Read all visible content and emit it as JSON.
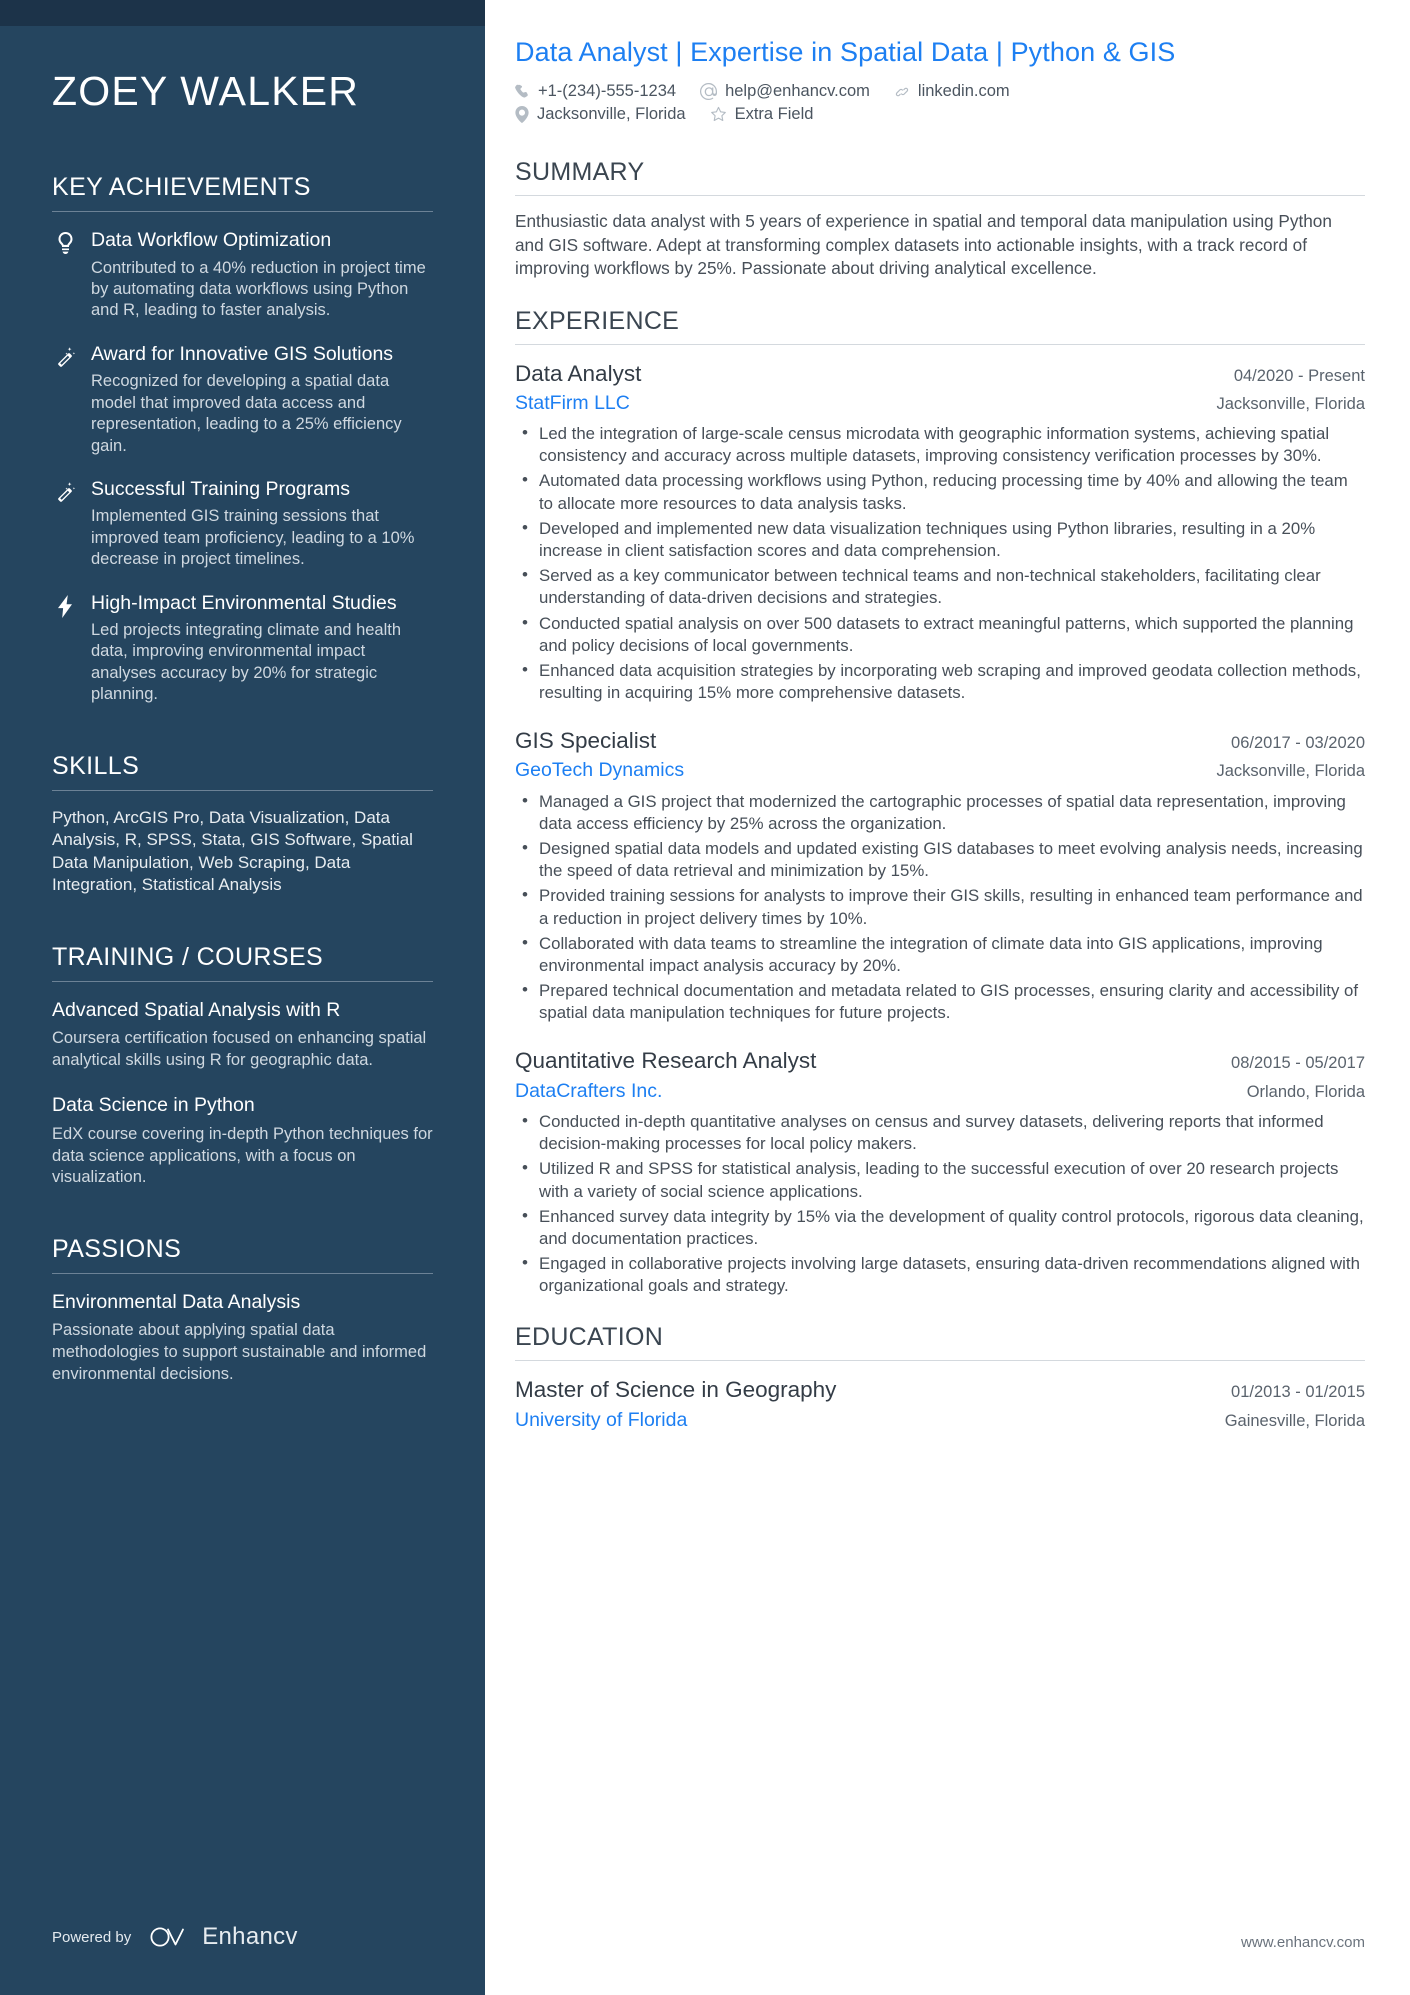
{
  "sidebar": {
    "name": "ZOEY WALKER",
    "achievements": {
      "heading": "KEY ACHIEVEMENTS",
      "items": [
        {
          "icon": "lightbulb-icon",
          "title": "Data Workflow Optimization",
          "description": "Contributed to a 40% reduction in project time by automating data workflows using Python and R, leading to faster analysis."
        },
        {
          "icon": "magic-wand-icon",
          "title": "Award for Innovative GIS Solutions",
          "description": "Recognized for developing a spatial data model that improved data access and representation, leading to a 25% efficiency gain."
        },
        {
          "icon": "magic-wand-icon",
          "title": "Successful Training Programs",
          "description": "Implemented GIS training sessions that improved team proficiency, leading to a 10% decrease in project timelines."
        },
        {
          "icon": "lightning-bolt-icon",
          "title": "High-Impact Environmental Studies",
          "description": "Led projects integrating climate and health data, improving environmental impact analyses accuracy by 20% for strategic planning."
        }
      ]
    },
    "skills": {
      "heading": "SKILLS",
      "text": "Python, ArcGIS Pro, Data Visualization, Data Analysis, R, SPSS, Stata, GIS Software, Spatial Data Manipulation, Web Scraping, Data Integration, Statistical Analysis"
    },
    "training": {
      "heading": "TRAINING / COURSES",
      "items": [
        {
          "title": "Advanced Spatial Analysis with R",
          "description": "Coursera certification focused on enhancing spatial analytical skills using R for geographic data."
        },
        {
          "title": "Data Science in Python",
          "description": "EdX course covering in-depth Python techniques for data science applications, with a focus on visualization."
        }
      ]
    },
    "passions": {
      "heading": "PASSIONS",
      "items": [
        {
          "title": "Environmental Data Analysis",
          "description": "Passionate about applying spatial data methodologies to support sustainable and informed environmental decisions."
        }
      ]
    },
    "powered_by": {
      "label": "Powered by",
      "brand": "Enhancv",
      "logo_icon": "enhancv-logo-icon"
    }
  },
  "header": {
    "headline": "Data Analyst | Expertise in Spatial Data | Python & GIS",
    "contacts": [
      {
        "icon": "phone-icon",
        "text": "+1-(234)-555-1234"
      },
      {
        "icon": "at-email-icon",
        "text": "help@enhancv.com"
      },
      {
        "icon": "link-icon",
        "text": "linkedin.com"
      },
      {
        "icon": "location-pin-icon",
        "text": "Jacksonville, Florida"
      },
      {
        "icon": "star-outline-icon",
        "text": "Extra Field"
      }
    ]
  },
  "summary": {
    "heading": "SUMMARY",
    "text": "Enthusiastic data analyst with 5 years of experience in spatial and temporal data manipulation using Python and GIS software. Adept at transforming complex datasets into actionable insights, with a track record of improving workflows by 25%. Passionate about driving analytical excellence."
  },
  "experience": {
    "heading": "EXPERIENCE",
    "jobs": [
      {
        "title": "Data Analyst",
        "date": "04/2020 - Present",
        "company": "StatFirm LLC",
        "location": "Jacksonville, Florida",
        "bullets": [
          "Led the integration of large-scale census microdata with geographic information systems, achieving spatial consistency and accuracy across multiple datasets, improving consistency verification processes by 30%.",
          "Automated data processing workflows using Python, reducing processing time by 40% and allowing the team to allocate more resources to data analysis tasks.",
          "Developed and implemented new data visualization techniques using Python libraries, resulting in a 20% increase in client satisfaction scores and data comprehension.",
          "Served as a key communicator between technical teams and non-technical stakeholders, facilitating clear understanding of data-driven decisions and strategies.",
          "Conducted spatial analysis on over 500 datasets to extract meaningful patterns, which supported the planning and policy decisions of local governments.",
          "Enhanced data acquisition strategies by incorporating web scraping and improved geodata collection methods, resulting in acquiring 15% more comprehensive datasets."
        ]
      },
      {
        "title": "GIS Specialist",
        "date": "06/2017 - 03/2020",
        "company": "GeoTech Dynamics",
        "location": "Jacksonville, Florida",
        "bullets": [
          "Managed a GIS project that modernized the cartographic processes of spatial data representation, improving data access efficiency by 25% across the organization.",
          "Designed spatial data models and updated existing GIS databases to meet evolving analysis needs, increasing the speed of data retrieval and minimization by 15%.",
          "Provided training sessions for analysts to improve their GIS skills, resulting in enhanced team performance and a reduction in project delivery times by 10%.",
          "Collaborated with data teams to streamline the integration of climate data into GIS applications, improving environmental impact analysis accuracy by 20%.",
          "Prepared technical documentation and metadata related to GIS processes, ensuring clarity and accessibility of spatial data manipulation techniques for future projects."
        ]
      },
      {
        "title": "Quantitative Research Analyst",
        "date": "08/2015 - 05/2017",
        "company": "DataCrafters Inc.",
        "location": "Orlando, Florida",
        "bullets": [
          "Conducted in-depth quantitative analyses on census and survey datasets, delivering reports that informed decision-making processes for local policy makers.",
          "Utilized R and SPSS for statistical analysis, leading to the successful execution of over 20 research projects with a variety of social science applications.",
          "Enhanced survey data integrity by 15% via the development of quality control protocols, rigorous data cleaning, and documentation practices.",
          "Engaged in collaborative projects involving large datasets, ensuring data-driven recommendations aligned with organizational goals and strategy."
        ]
      }
    ]
  },
  "education": {
    "heading": "EDUCATION",
    "items": [
      {
        "degree": "Master of Science in Geography",
        "date": "01/2013 - 01/2015",
        "school": "University of Florida",
        "location": "Gainesville, Florida"
      }
    ]
  },
  "footer": {
    "website": "www.enhancv.com"
  },
  "colors": {
    "sidebar_bg": "#25455f",
    "sidebar_topbar": "#1c3349",
    "accent_blue": "#1d7ff2",
    "heading_gray": "#3a4550",
    "body_text": "#474f58"
  }
}
